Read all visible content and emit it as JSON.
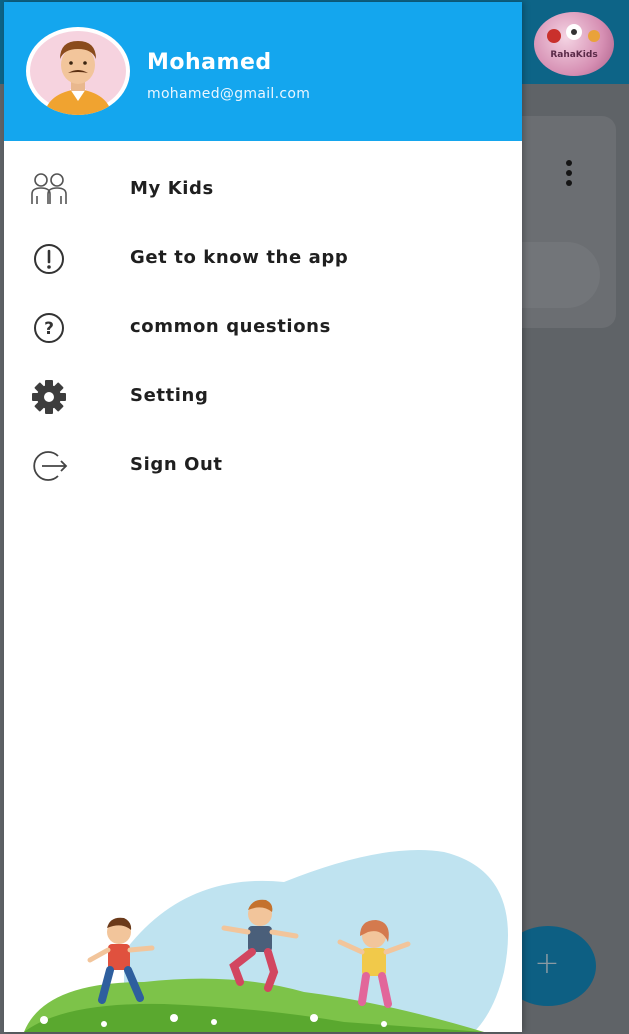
{
  "user": {
    "name": "Mohamed",
    "email": "mohamed@gmail.com"
  },
  "menu": [
    {
      "label": "My Kids",
      "icon": "kids-icon"
    },
    {
      "label": "Get to know the app",
      "icon": "info-icon"
    },
    {
      "label": "common questions",
      "icon": "question-icon"
    },
    {
      "label": "Setting",
      "icon": "gear-icon"
    },
    {
      "label": "Sign Out",
      "icon": "sign-out-icon"
    }
  ],
  "background_app": {
    "logo_text": "RahaKids",
    "fab_label": "+"
  },
  "colors": {
    "drawer_header": "#14a6ee",
    "app_bar": "#0d6487",
    "scrim": "#5f6367"
  }
}
